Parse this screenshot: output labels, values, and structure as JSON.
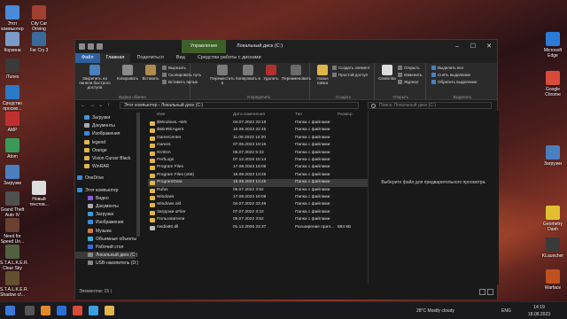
{
  "desktop": {
    "left_icons": [
      "Этот компьютер",
      "Корзина",
      "iTunes",
      "Средство просмо...",
      "AMP",
      "Atom",
      "Загрузки",
      "Grand Theft Auto IV",
      "Need for Speed Un...",
      "S.T.A.L.K.E.R. Clear Sky",
      "S.T.A.L.K.E.R. Shadow of..."
    ],
    "left_icons2": [
      "City Car Driving",
      "Far Cry 3",
      "Новый текстов..."
    ],
    "right_icons": [
      "Microsoft Edge",
      "Google Chrome",
      "Загрузки",
      "Geometry Dash",
      "KLauncher",
      "Warface"
    ]
  },
  "window": {
    "title": "Локальный диск (C:)",
    "context_tab": "Управление",
    "tabs": [
      "Файл",
      "Главная",
      "Поделиться",
      "Вид",
      "Средства работы с дисками"
    ],
    "ribbon": {
      "pin": "Закрепить на панели быстрого доступа",
      "copy": "Копировать",
      "paste": "Вставить",
      "cut": "Вырезать",
      "copy_path": "Скопировать путь",
      "paste_shortcut": "Вставить ярлык",
      "clipboard": "Буфер обмена",
      "move_to": "Переместить в",
      "copy_to": "Копировать в",
      "delete": "Удалить",
      "rename": "Переименовать",
      "organize": "Упорядочить",
      "new_folder": "Новая папка",
      "new_item": "Создать элемент",
      "easy_access": "Простой доступ",
      "create": "Создать",
      "properties": "Свойства",
      "open": "Открыть",
      "edit": "Изменить",
      "history": "Журнал",
      "open_group": "Открыть",
      "select_all": "Выделить все",
      "select_none": "Снять выделение",
      "invert": "Обратить выделение",
      "select_group": "Выделить"
    },
    "address": "Этот компьютер  ›  Локальный диск (C:)",
    "search_placeholder": "Поиск: Локальный диск (C:)",
    "nav": [
      "Загрузки",
      "Документы",
      "Изображения",
      "legend",
      "Orange",
      "Vision Cursor Black",
      "WinRAR",
      "OneDrive",
      "Этот компьютер",
      "Видео",
      "Документы",
      "Загрузки",
      "Изображения",
      "Музыка",
      "Объемные объекты",
      "Рабочий стол",
      "Локальный диск (C:)",
      "USB-накопитель (D:)"
    ],
    "columns": [
      "Имя",
      "Дата изменения",
      "Тип",
      "Размер"
    ],
    "files": [
      {
        "name": "$Windows.~WS",
        "date": "04.07.2022 23:19",
        "type": "Папка с файлами",
        "size": ""
      },
      {
        "name": "$WinREAgent",
        "date": "10.06.2023 22:45",
        "type": "Папка с файлами",
        "size": ""
      },
      {
        "name": "GameCenter",
        "date": "11.08.2023 13:30",
        "type": "Папка с файлами",
        "size": ""
      },
      {
        "name": "Games",
        "date": "07.06.2023 19:16",
        "type": "Папка с файлами",
        "size": ""
      },
      {
        "name": "NVIDIA",
        "date": "05.07.2022 5:33",
        "type": "Папка с файлами",
        "size": ""
      },
      {
        "name": "PerfLogs",
        "date": "07.12.2019 15:14",
        "type": "Папка с файлами",
        "size": ""
      },
      {
        "name": "Program Files",
        "date": "17.08.2023 18:08",
        "type": "Папка с файлами",
        "size": ""
      },
      {
        "name": "Program Files (x86)",
        "date": "18.08.2023 13:45",
        "type": "Папка с файлами",
        "size": ""
      },
      {
        "name": "ProgramData",
        "date": "18.08.2023 13:45",
        "type": "Папка с файлами",
        "size": ""
      },
      {
        "name": "Rufus",
        "date": "05.07.2022 3:52",
        "type": "Папка с файлами",
        "size": ""
      },
      {
        "name": "Windows",
        "date": "17.08.2023 18:09",
        "type": "Папка с файлами",
        "size": ""
      },
      {
        "name": "Windows.old",
        "date": "04.07.2022 23:49",
        "type": "Папка с файлами",
        "size": ""
      },
      {
        "name": "Загрузки uFiler",
        "date": "07.07.2022 3:22",
        "type": "Папка с файлами",
        "size": ""
      },
      {
        "name": "Пользователи",
        "date": "05.07.2022 3:52",
        "type": "Папка с файлами",
        "size": ""
      },
      {
        "name": "msdia80.dll",
        "date": "01.12.2006 23:37",
        "type": "Расширение прил...",
        "size": "884 КБ"
      }
    ],
    "selected_index": 8,
    "preview_text": "Выберите файл для предварительного просмотра.",
    "status": "Элементов: 15  |"
  },
  "taskbar": {
    "weather": "28°C  Mostly cloudy",
    "lang": "ENG",
    "time": "14:19",
    "date": "18.08.2023"
  }
}
